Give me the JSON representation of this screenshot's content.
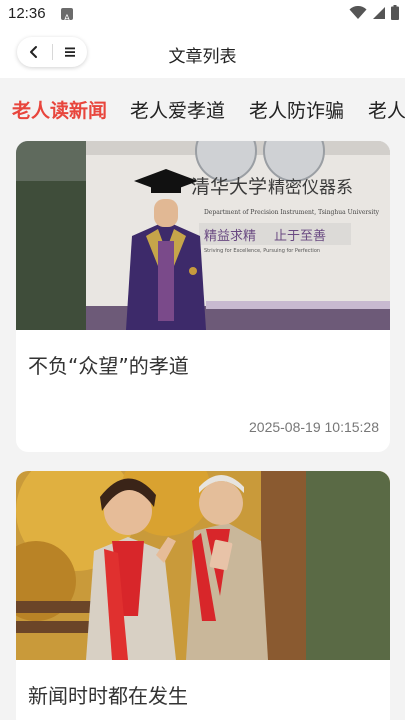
{
  "status_bar": {
    "time": "12:36",
    "app_icon": "a-letter-icon",
    "icons": [
      "wifi-icon",
      "signal-icon",
      "battery-icon"
    ]
  },
  "header": {
    "title": "文章列表",
    "back_icon": "chevron-left-icon",
    "menu_icon": "menu-icon"
  },
  "tabs": [
    {
      "label": "老人读新闻",
      "active": true
    },
    {
      "label": "老人爱孝道",
      "active": false
    },
    {
      "label": "老人防诈骗",
      "active": false
    },
    {
      "label": "老人",
      "active": false
    }
  ],
  "articles": [
    {
      "title": "不负“众望”的孝道",
      "date": "2025-08-19 10:15:28",
      "image": {
        "sign_school": "清华大学",
        "sign_department": "精密仪器系",
        "sign_english": "Department of Precision Instrument, Tsinghua University",
        "motto_1": "精益求精",
        "motto_2": "止于至善",
        "motto_english": "Striving for Excellence, Pursuing for Perfection"
      }
    },
    {
      "title": "新闻时时都在发生",
      "date": "",
      "image": {}
    }
  ],
  "colors": {
    "accent": "#e8453c",
    "background": "#f3f3f3",
    "card": "#ffffff"
  }
}
